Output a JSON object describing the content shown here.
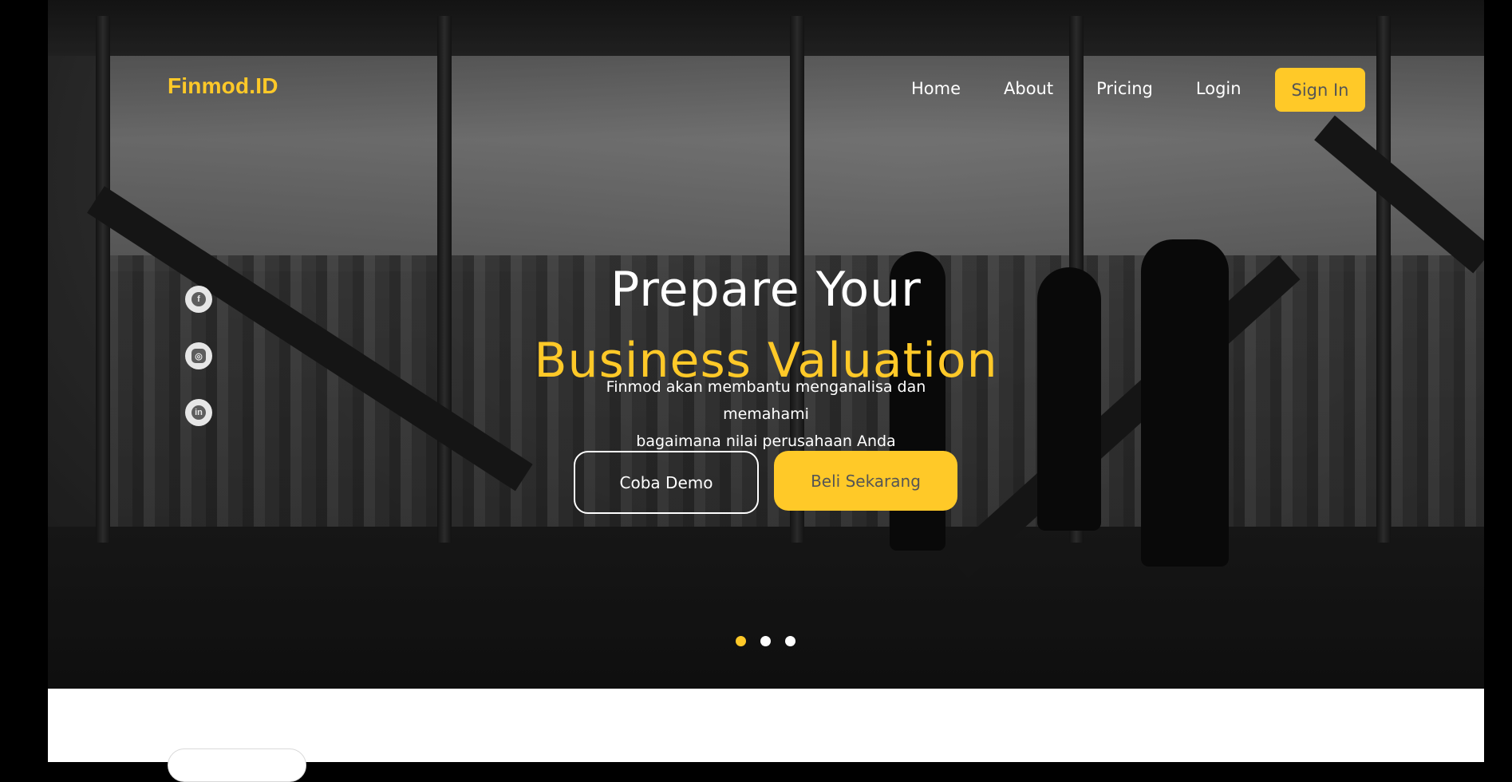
{
  "brand": {
    "logo": "Finmod.ID",
    "accent": "#FFC928"
  },
  "nav": {
    "items": [
      {
        "label": "Home"
      },
      {
        "label": "About"
      },
      {
        "label": "Pricing"
      },
      {
        "label": "Login"
      }
    ],
    "signin_label": "Sign In"
  },
  "social": [
    {
      "icon": "facebook-icon",
      "glyph": "f"
    },
    {
      "icon": "instagram-icon",
      "glyph": "◎"
    },
    {
      "icon": "linkedin-icon",
      "glyph": "in"
    }
  ],
  "hero": {
    "title_line1": "Prepare Your",
    "title_line2": "Business Valuation",
    "subtitle_line1": "Finmod akan membantu menganalisa dan",
    "subtitle_line2": "memahami",
    "subtitle_line3": "bagaimana nilai perusahaan Anda",
    "demo_label": "Coba Demo",
    "buy_label": "Beli Sekarang"
  },
  "carousel": {
    "slide_count": 3,
    "active_index": 0
  }
}
